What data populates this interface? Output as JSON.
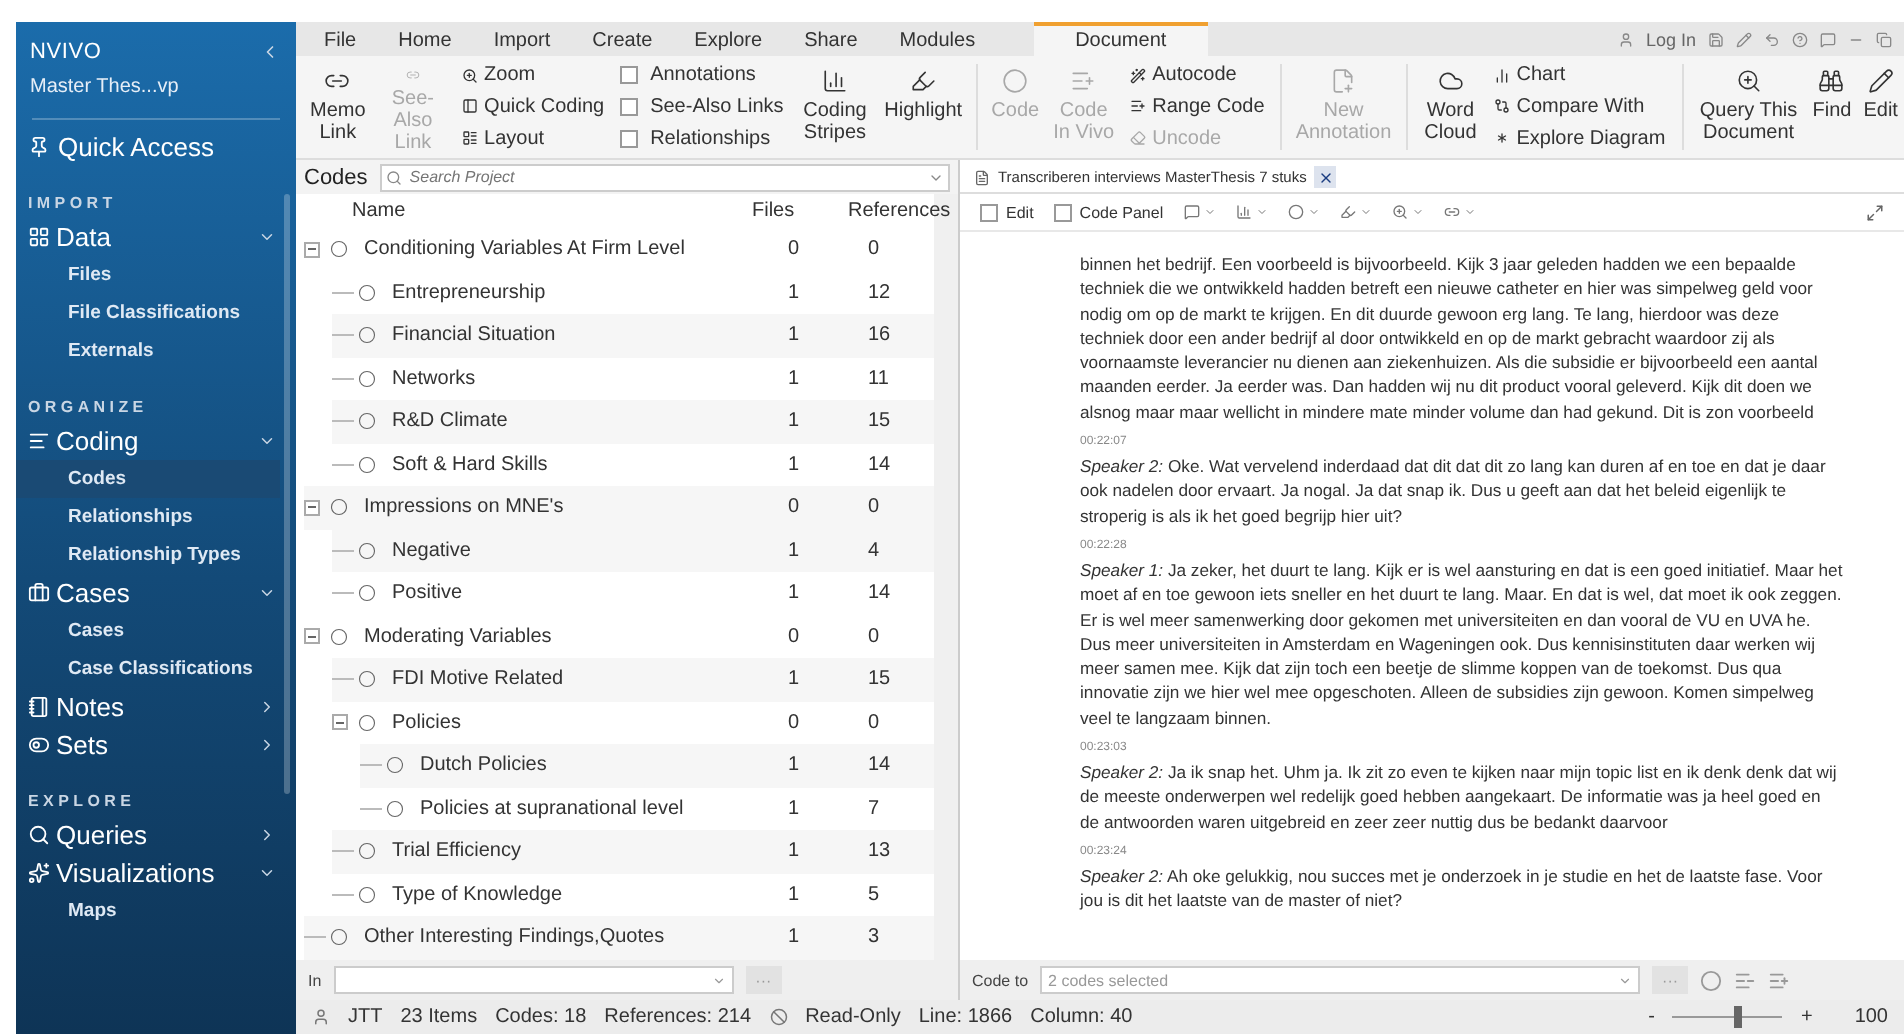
{
  "app": {
    "logo": "NVIVO",
    "project": "Master Thes...vp"
  },
  "sidebar": {
    "quick_access": "Quick Access",
    "sections": [
      {
        "heading": "IMPORT",
        "groups": [
          {
            "label": "Data",
            "expanded": true,
            "children": [
              {
                "label": "Files",
                "selected": false
              },
              {
                "label": "File Classifications",
                "selected": false
              },
              {
                "label": "Externals",
                "selected": false
              }
            ]
          }
        ]
      },
      {
        "heading": "ORGANIZE",
        "groups": [
          {
            "label": "Coding",
            "expanded": true,
            "children": [
              {
                "label": "Codes",
                "selected": true
              },
              {
                "label": "Relationships",
                "selected": false
              },
              {
                "label": "Relationship Types",
                "selected": false
              }
            ]
          },
          {
            "label": "Cases",
            "expanded": true,
            "children": [
              {
                "label": "Cases",
                "selected": false
              },
              {
                "label": "Case Classifications",
                "selected": false
              }
            ]
          },
          {
            "label": "Notes",
            "expanded": false
          },
          {
            "label": "Sets",
            "expanded": false
          }
        ]
      },
      {
        "heading": "EXPLORE",
        "groups": [
          {
            "label": "Queries",
            "expanded": false
          },
          {
            "label": "Visualizations",
            "expanded": true,
            "children": [
              {
                "label": "Maps",
                "selected": false
              }
            ]
          }
        ]
      }
    ]
  },
  "ribbon_tabs": [
    {
      "label": "File",
      "selected": false
    },
    {
      "label": "Home",
      "selected": false
    },
    {
      "label": "Import",
      "selected": false
    },
    {
      "label": "Create",
      "selected": false
    },
    {
      "label": "Explore",
      "selected": false
    },
    {
      "label": "Share",
      "selected": false
    },
    {
      "label": "Modules",
      "selected": false
    },
    {
      "label": "Document",
      "selected": true
    }
  ],
  "login": "Log In",
  "ribbon": [
    {
      "kind": "large",
      "label": "Memo Link",
      "disabled": false
    },
    {
      "kind": "large",
      "label": "See-Also Link",
      "disabled": true
    },
    {
      "kind": "small",
      "items": [
        {
          "label": "Zoom",
          "disabled": false
        },
        {
          "label": "Quick Coding",
          "disabled": false
        },
        {
          "label": "Layout",
          "disabled": false
        }
      ]
    },
    {
      "kind": "checks",
      "items": [
        {
          "label": "Annotations",
          "checked": false
        },
        {
          "label": "See-Also Links",
          "checked": false
        },
        {
          "label": "Relationships",
          "checked": false
        }
      ]
    },
    {
      "kind": "large",
      "label": "Coding Stripes",
      "disabled": false
    },
    {
      "kind": "large",
      "label": "Highlight",
      "disabled": false
    },
    {
      "kind": "separator"
    },
    {
      "kind": "large",
      "label": "Code",
      "disabled": true
    },
    {
      "kind": "large",
      "label": "Code In Vivo",
      "disabled": true
    },
    {
      "kind": "small",
      "items": [
        {
          "label": "Autocode",
          "disabled": false
        },
        {
          "label": "Range Code",
          "disabled": false
        },
        {
          "label": "Uncode",
          "disabled": true
        }
      ]
    },
    {
      "kind": "separator"
    },
    {
      "kind": "large",
      "label": "New Annotation",
      "disabled": true
    },
    {
      "kind": "separator"
    },
    {
      "kind": "large",
      "label": "Word Cloud",
      "disabled": false
    },
    {
      "kind": "small",
      "items": [
        {
          "label": "Chart",
          "disabled": false
        },
        {
          "label": "Compare With",
          "disabled": false
        },
        {
          "label": "Explore Diagram",
          "disabled": false
        }
      ]
    },
    {
      "kind": "separator"
    },
    {
      "kind": "large",
      "label": "Query This Document",
      "disabled": false
    },
    {
      "kind": "large",
      "label": "Find",
      "disabled": false
    },
    {
      "kind": "large",
      "label": "Edit",
      "disabled": false
    }
  ],
  "codes_panel": {
    "title": "Codes",
    "search_placeholder": "Search Project",
    "columns": [
      "Name",
      "Files",
      "References"
    ],
    "codes": [
      {
        "name": "Conditioning Variables At Firm Level",
        "files": "0",
        "references": "0",
        "expanded": true,
        "children": [
          {
            "name": "Entrepreneurship",
            "files": "1",
            "references": "12"
          },
          {
            "name": "Financial Situation",
            "files": "1",
            "references": "16"
          },
          {
            "name": "Networks",
            "files": "1",
            "references": "11"
          },
          {
            "name": "R&D Climate",
            "files": "1",
            "references": "15"
          },
          {
            "name": "Soft & Hard Skills",
            "files": "1",
            "references": "14"
          }
        ]
      },
      {
        "name": "Impressions on MNE's",
        "files": "0",
        "references": "0",
        "expanded": true,
        "children": [
          {
            "name": "Negative",
            "files": "1",
            "references": "4"
          },
          {
            "name": "Positive",
            "files": "1",
            "references": "14"
          }
        ]
      },
      {
        "name": "Moderating Variables",
        "files": "0",
        "references": "0",
        "expanded": true,
        "children": [
          {
            "name": "FDI Motive Related",
            "files": "1",
            "references": "15"
          },
          {
            "name": "Policies",
            "files": "0",
            "references": "0",
            "expanded": true,
            "children": [
              {
                "name": "Dutch Policies",
                "files": "1",
                "references": "14"
              },
              {
                "name": "Policies at supranational level",
                "files": "1",
                "references": "7"
              }
            ]
          },
          {
            "name": "Trial Efficiency",
            "files": "1",
            "references": "13"
          },
          {
            "name": "Type of Knowledge",
            "files": "1",
            "references": "5"
          }
        ]
      },
      {
        "name": "Other Interesting Findings,Quotes",
        "files": "1",
        "references": "3"
      }
    ],
    "in_label": "In",
    "more": "···"
  },
  "document": {
    "tab": "Transcriberen interviews MasterThesis 7 stuks",
    "checks": [
      {
        "label": "Edit",
        "checked": false
      },
      {
        "label": "Code Panel",
        "checked": false
      }
    ],
    "blocks": [
      {
        "text": "binnen het bedrijf. Een voorbeeld is bijvoorbeeld. Kijk 3 jaar geleden hadden we een bepaalde techniek die we ontwikkeld hadden betreft een nieuwe catheter en hier was simpelweg geld voor nodig om op de markt te krijgen. En dit duurde gewoon erg lang. Te lang, hierdoor was deze techniek door een ander bedrijf al door ontwikkeld en op de markt gebracht waardoor zij als voornaamste leverancier nu dienen aan ziekenhuizen. Als die subsidie er bijvoorbeeld een aantal maanden eerder. Ja eerder was. Dan hadden wij nu dit product vooral geleverd. Kijk dit doen we alsnog maar maar wellicht in mindere mate minder volume dan had gekund. Dit is zon voorbeeld"
      },
      {
        "timestamp": "00:22:07",
        "text": "*Speaker 2:* Oke. Wat vervelend inderdaad dat dit dat dit zo lang kan duren af en toe en dat je daar ook nadelen door ervaart. Ja nogal. Ja dat snap ik. Dus u geeft aan dat het beleid eigenlijk te stroperig is als ik het goed begrijp hier uit?"
      },
      {
        "timestamp": "00:22:28",
        "text": "*Speaker 1:* Ja zeker, het duurt te lang. Kijk er is wel aansturing en dat is een goed initiatief. Maar het moet af en toe gewoon iets sneller en het duurt te lang. Maar. En dat is wel, dat moet ik ook zeggen. Er is wel meer samenwerking door gekomen met universiteiten en dan vooral de VU en UVA he. Dus meer universiteiten in Amsterdam en Wageningen ook. Dus kennisinstituten daar werken wij meer samen mee. Kijk dat zijn toch een beetje de slimme koppen van de toekomst. Dus qua innovatie zijn we hier wel mee opgeschoten. Alleen de subsidies zijn gewoon. Komen simpelweg veel te langzaam binnen."
      },
      {
        "timestamp": "00:23:03",
        "text": "*Speaker 2:* Ja ik snap het. Uhm ja. Ik zit zo even te kijken naar mijn topic list en ik denk denk dat wij de meeste onderwerpen wel redelijk goed hebben aangekaart. De informatie was ja heel goed en de antwoorden waren uitgebreid en zeer zeer nuttig dus be bedankt daarvoor"
      },
      {
        "timestamp": "00:23:24",
        "text": "*Speaker 2:* Ah oke gelukkig, nou succes met je onderzoek in je studie en het de laatste fase. Voor jou is dit het laatste van de master of niet?"
      }
    ],
    "code_to_label": "Code to",
    "code_to_value": "2 codes selected",
    "more": "···"
  },
  "status_bar": {
    "user": "JTT",
    "items": "23 Items",
    "codes": "Codes: 18",
    "references": "References: 214",
    "mode": "Read-Only",
    "line": "Line: 1866",
    "column": "Column: 40",
    "zoom": {
      "level": 0.6,
      "minus": "-",
      "plus": "+",
      "reading": "100"
    }
  }
}
